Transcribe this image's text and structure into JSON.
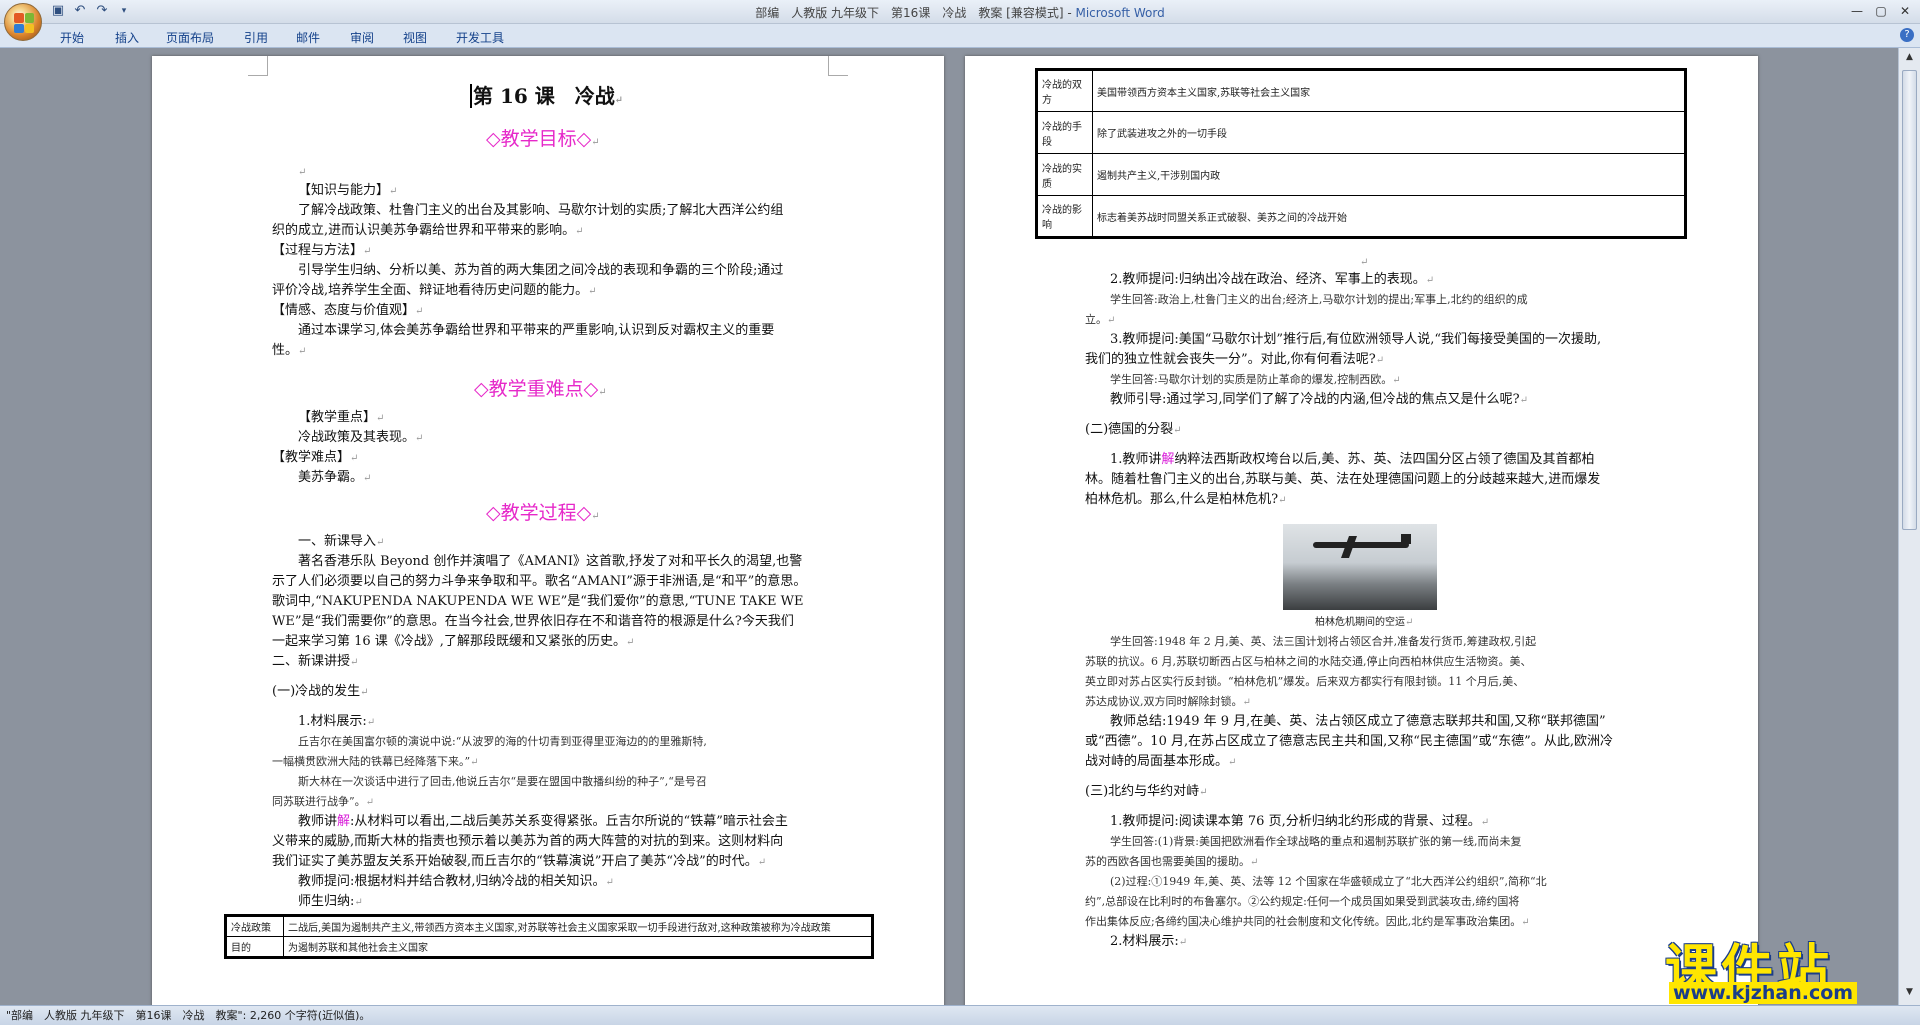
{
  "window": {
    "title_doc": "部编　人教版 九年级下　第16课　冷战　教案 [兼容模式]",
    "title_sep": " - ",
    "title_app": "Microsoft Word",
    "minimize_icon": "minimize-icon",
    "maximize_icon": "maximize-icon",
    "close_icon": "close-icon"
  },
  "ribbon": {
    "tabs": [
      "开始",
      "插入",
      "页面布局",
      "引用",
      "邮件",
      "审阅",
      "视图",
      "开发工具"
    ],
    "help": "?"
  },
  "page1": {
    "title": "第 16 课　冷战",
    "sec1": "◇教学目标◇",
    "k1": "【知识与能力】",
    "k1_text_a": "了解冷战政策、杜鲁门主义的出台及其影响、马歇尔计划的实质;了解北大西洋公约组",
    "k1_text_b": "织的成立,进而认识美苏争霸给世界和平带来的影响。",
    "k2": "【过程与方法】",
    "k2_text_a": "引导学生归纳、分析以美、苏为首的两大集团之间冷战的表现和争霸的三个阶段;通过",
    "k2_text_b": "评价冷战,培养学生全面、辩证地看待历史问题的能力。",
    "k3": "【情感、态度与价值观】",
    "k3_text_a": "通过本课学习,体会美苏争霸给世界和平带来的严重影响,认识到反对霸权主义的重要",
    "k3_text_b": "性。",
    "sec2": "◇教学重难点◇",
    "z1": "【教学重点】",
    "z1_text": "冷战政策及其表现。",
    "z2": "【教学难点】",
    "z2_text": "美苏争霸。",
    "sec3": "◇教学过程◇",
    "p_intro": "一、新课导入",
    "p_intro_l1": "著名香港乐队 Beyond 创作并演唱了《AMANI》这首歌,抒发了对和平长久的渴望,也警",
    "p_intro_l2": "示了人们必须要以自己的努力斗争来争取和平。歌名“AMANI”源于非洲语,是“和平”的意思。",
    "p_intro_l3": "歌词中,“NAKUPENDA NAKUPENDA WE WE”是“我们爱你”的意思,“TUNE TAKE WE",
    "p_intro_l4": "WE”是“我们需要你”的意思。在当今社会,世界依旧存在不和谐音符的根源是什么?今天我们",
    "p_intro_l5": "一起来学习第 16 课《冷战》,了解那段既缓和又紧张的历史。",
    "p_new": "二、新课讲授",
    "p_sub1": "(一)冷战的发生",
    "p_mat": "1.材料展示:",
    "p_q1": "丘吉尔在美国富尔顿的演说中说:“从波罗的海的什切青到亚得里亚海边的的里雅斯特,",
    "p_q2": "一幅横贯欧洲大陆的铁幕已经降落下来。”",
    "p_q3": "斯大林在一次谈话中进行了回击,他说丘吉尔“是要在盟国中散播纠纷的种子”,“是号召",
    "p_q4": "同苏联进行战争”。",
    "p_t1_pre": "教师讲",
    "p_t1_mark": "解",
    "p_t1_rest": ":从材料可以看出,二战后美苏关系变得紧张。丘吉尔所说的“铁幕”暗示社会主",
    "p_t2": "义带来的威胁,而斯大林的指责也预示着以美苏为首的两大阵营的对抗的到来。这则材料向",
    "p_t3": "我们证实了美苏盟友关系开始破裂,而丘吉尔的“铁幕演说”开启了美苏“冷战”的时代。",
    "p_t4": "教师提问:根据材料并结合教材,归纳冷战的相关知识。",
    "p_t5": "师生归纳:",
    "table": [
      {
        "k": "冷战政策",
        "v": "二战后,美国为遏制共产主义,带领西方资本主义国家,对苏联等社会主义国家采取一切手段进行敌对,这种政策被称为冷战政策"
      },
      {
        "k": "目的",
        "v": "为遏制苏联和其他社会主义国家"
      }
    ]
  },
  "page2": {
    "table": [
      {
        "k": "冷战的双方",
        "v": "美国带领西方资本主义国家,苏联等社会主义国家"
      },
      {
        "k": "冷战的手段",
        "v": "除了武装进攻之外的一切手段"
      },
      {
        "k": "冷战的实质",
        "v": "遏制共产主义,干涉别国内政"
      },
      {
        "k": "冷战的影响",
        "v": "标志着美苏战时同盟关系正式破裂、美苏之间的冷战开始"
      }
    ],
    "l1": "2.教师提问:归纳出冷战在政治、经济、军事上的表现。",
    "l2": "学生回答:政治上,杜鲁门主义的出台;经济上,马歇尔计划的提出;军事上,北约的组织的成",
    "l3": "立。",
    "l4": "3.教师提问:美国“马歇尔计划”推行后,有位欧洲领导人说,“我们每接受美国的一次援助,",
    "l5": "我们的独立性就会丧失一分”。对此,你有何看法呢?",
    "l6": "学生回答:马歇尔计划的实质是防止革命的爆发,控制西欧。",
    "l7": "教师引导:通过学习,同学们了解了冷战的内涵,但冷战的焦点又是什么呢?",
    "s2": "(二)德国的分裂",
    "m1_pre": "1.教师讲",
    "m1_mark": "解",
    "m1_rest": "纳粹法西斯政权垮台以后,美、苏、英、法四国分区占领了德国及其首都柏",
    "m2": "林。随着杜鲁门主义的出台,苏联与美、英、法在处理德国问题上的分歧越来越大,进而爆发",
    "m3": "柏林危机。那么,什么是柏林危机?",
    "caption": "柏林危机期间的空运",
    "a1": "学生回答:1948 年 2 月,美、英、法三国计划将占领区合并,准备发行货币,筹建政权,引起",
    "a2": "苏联的抗议。6 月,苏联切断西占区与柏林之间的水陆交通,停止向西柏林供应生活物资。美、",
    "a3": "英立即对苏占区实行反封锁。“柏林危机”爆发。后来双方都实行有限封锁。11 个月后,美、",
    "a4": "苏达成协议,双方同时解除封锁。",
    "a5": "教师总结:1949 年 9 月,在美、英、法占领区成立了德意志联邦共和国,又称“联邦德国”",
    "a6": "或“西德”。10 月,在苏占区成立了德意志民主共和国,又称“民主德国”或“东德”。从此,欧洲冷",
    "a7": "战对峙的局面基本形成。",
    "s3": "(三)北约与华约对峙",
    "b1": "1.教师提问:阅读课本第 76 页,分析归纳北约形成的背景、过程。",
    "b2": "学生回答:(1)背景:美国把欧洲看作全球战略的重点和遏制苏联扩张的第一线,而尚未复",
    "b3": "苏的西欧各国也需要美国的援助。",
    "b4": "(2)过程:①1949 年,美、英、法等 12 个国家在华盛顿成立了“北大西洋公约组织”,简称“北",
    "b5": "约”,总部设在比利时的布鲁塞尔。②公约规定:任何一个成员国如果受到武装攻击,缔约国将",
    "b6": "作出集体反应;各缔约国决心维护共同的社会制度和文化传统。因此,北约是军事政治集团。",
    "b7": "2.材料展示:"
  },
  "statusbar": {
    "text": "\"部编　人教版 九年级下　第16课　冷战　教案\": 2,260 个字符(近似值)。"
  },
  "watermark": {
    "main": "课件站",
    "url": "www.kjzhan.com"
  },
  "colors": {
    "accent_heading": "#e628c9",
    "brand_title": "#355fa6",
    "ribbon_text": "#15428b"
  }
}
